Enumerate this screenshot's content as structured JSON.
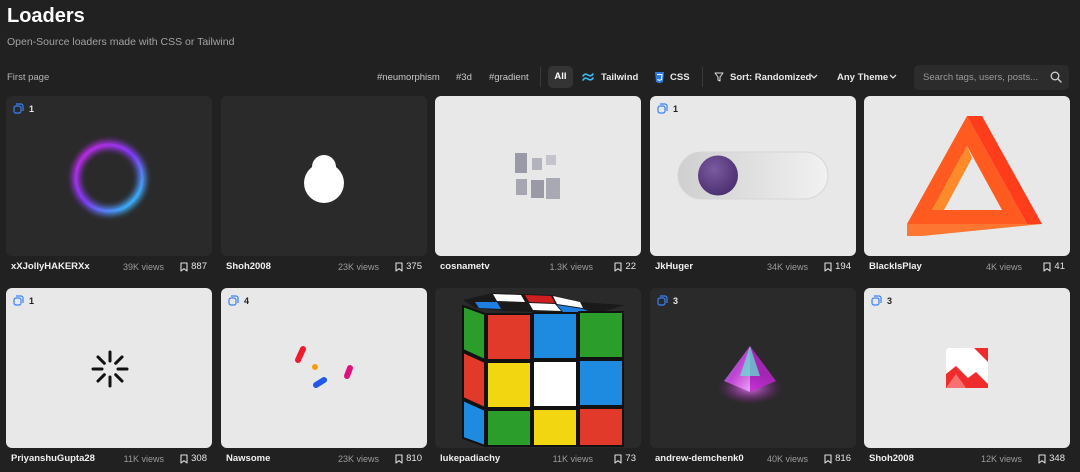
{
  "header": {
    "title": "Loaders",
    "subtitle": "Open-Source loaders made with CSS or Tailwind"
  },
  "toolbar": {
    "first_page": "First page",
    "tags": [
      "#neumorphism",
      "#3d",
      "#gradient"
    ],
    "all_label": "All",
    "tailwind_label": "Tailwind",
    "css_label": "CSS",
    "sort_label": "Sort: Randomized",
    "theme_label": "Any Theme",
    "search_placeholder": "Search tags, users, posts..."
  },
  "colors": {
    "background": "#212121",
    "tailwind_icon": "#38bdf8",
    "css_icon": "#2f7ddf",
    "badge_icon": "#3b82f6"
  },
  "cards": [
    {
      "author": "xXJollyHAKERXx",
      "views": "39K views",
      "saves": "887",
      "badge": "1",
      "theme": "dark",
      "preview": "gradient-ring"
    },
    {
      "author": "Shoh2008",
      "views": "23K views",
      "saves": "375",
      "badge": "",
      "theme": "dark",
      "preview": "white-blob"
    },
    {
      "author": "cosnametv",
      "views": "1.3K views",
      "saves": "22",
      "badge": "",
      "theme": "light",
      "preview": "grey-blocks"
    },
    {
      "author": "JkHuger",
      "views": "34K views",
      "saves": "194",
      "badge": "1",
      "theme": "light",
      "preview": "neumorphic-toggle"
    },
    {
      "author": "BlackIsPlay",
      "views": "4K views",
      "saves": "41",
      "badge": "",
      "theme": "light",
      "preview": "penrose-triangle"
    },
    {
      "author": "PriyanshuGupta28",
      "views": "11K views",
      "saves": "308",
      "badge": "1",
      "theme": "light",
      "preview": "spinner"
    },
    {
      "author": "Nawsome",
      "views": "23K views",
      "saves": "810",
      "badge": "4",
      "theme": "light",
      "preview": "confetti-dots"
    },
    {
      "author": "lukepadiachy",
      "views": "11K views",
      "saves": "73",
      "badge": "",
      "theme": "dark",
      "preview": "rubiks-cube"
    },
    {
      "author": "andrew-demchenk0",
      "views": "40K views",
      "saves": "816",
      "badge": "3",
      "theme": "dark",
      "preview": "glowing-pyramid"
    },
    {
      "author": "Shoh2008",
      "views": "12K views",
      "saves": "348",
      "badge": "3",
      "theme": "light",
      "preview": "image-icon"
    }
  ]
}
